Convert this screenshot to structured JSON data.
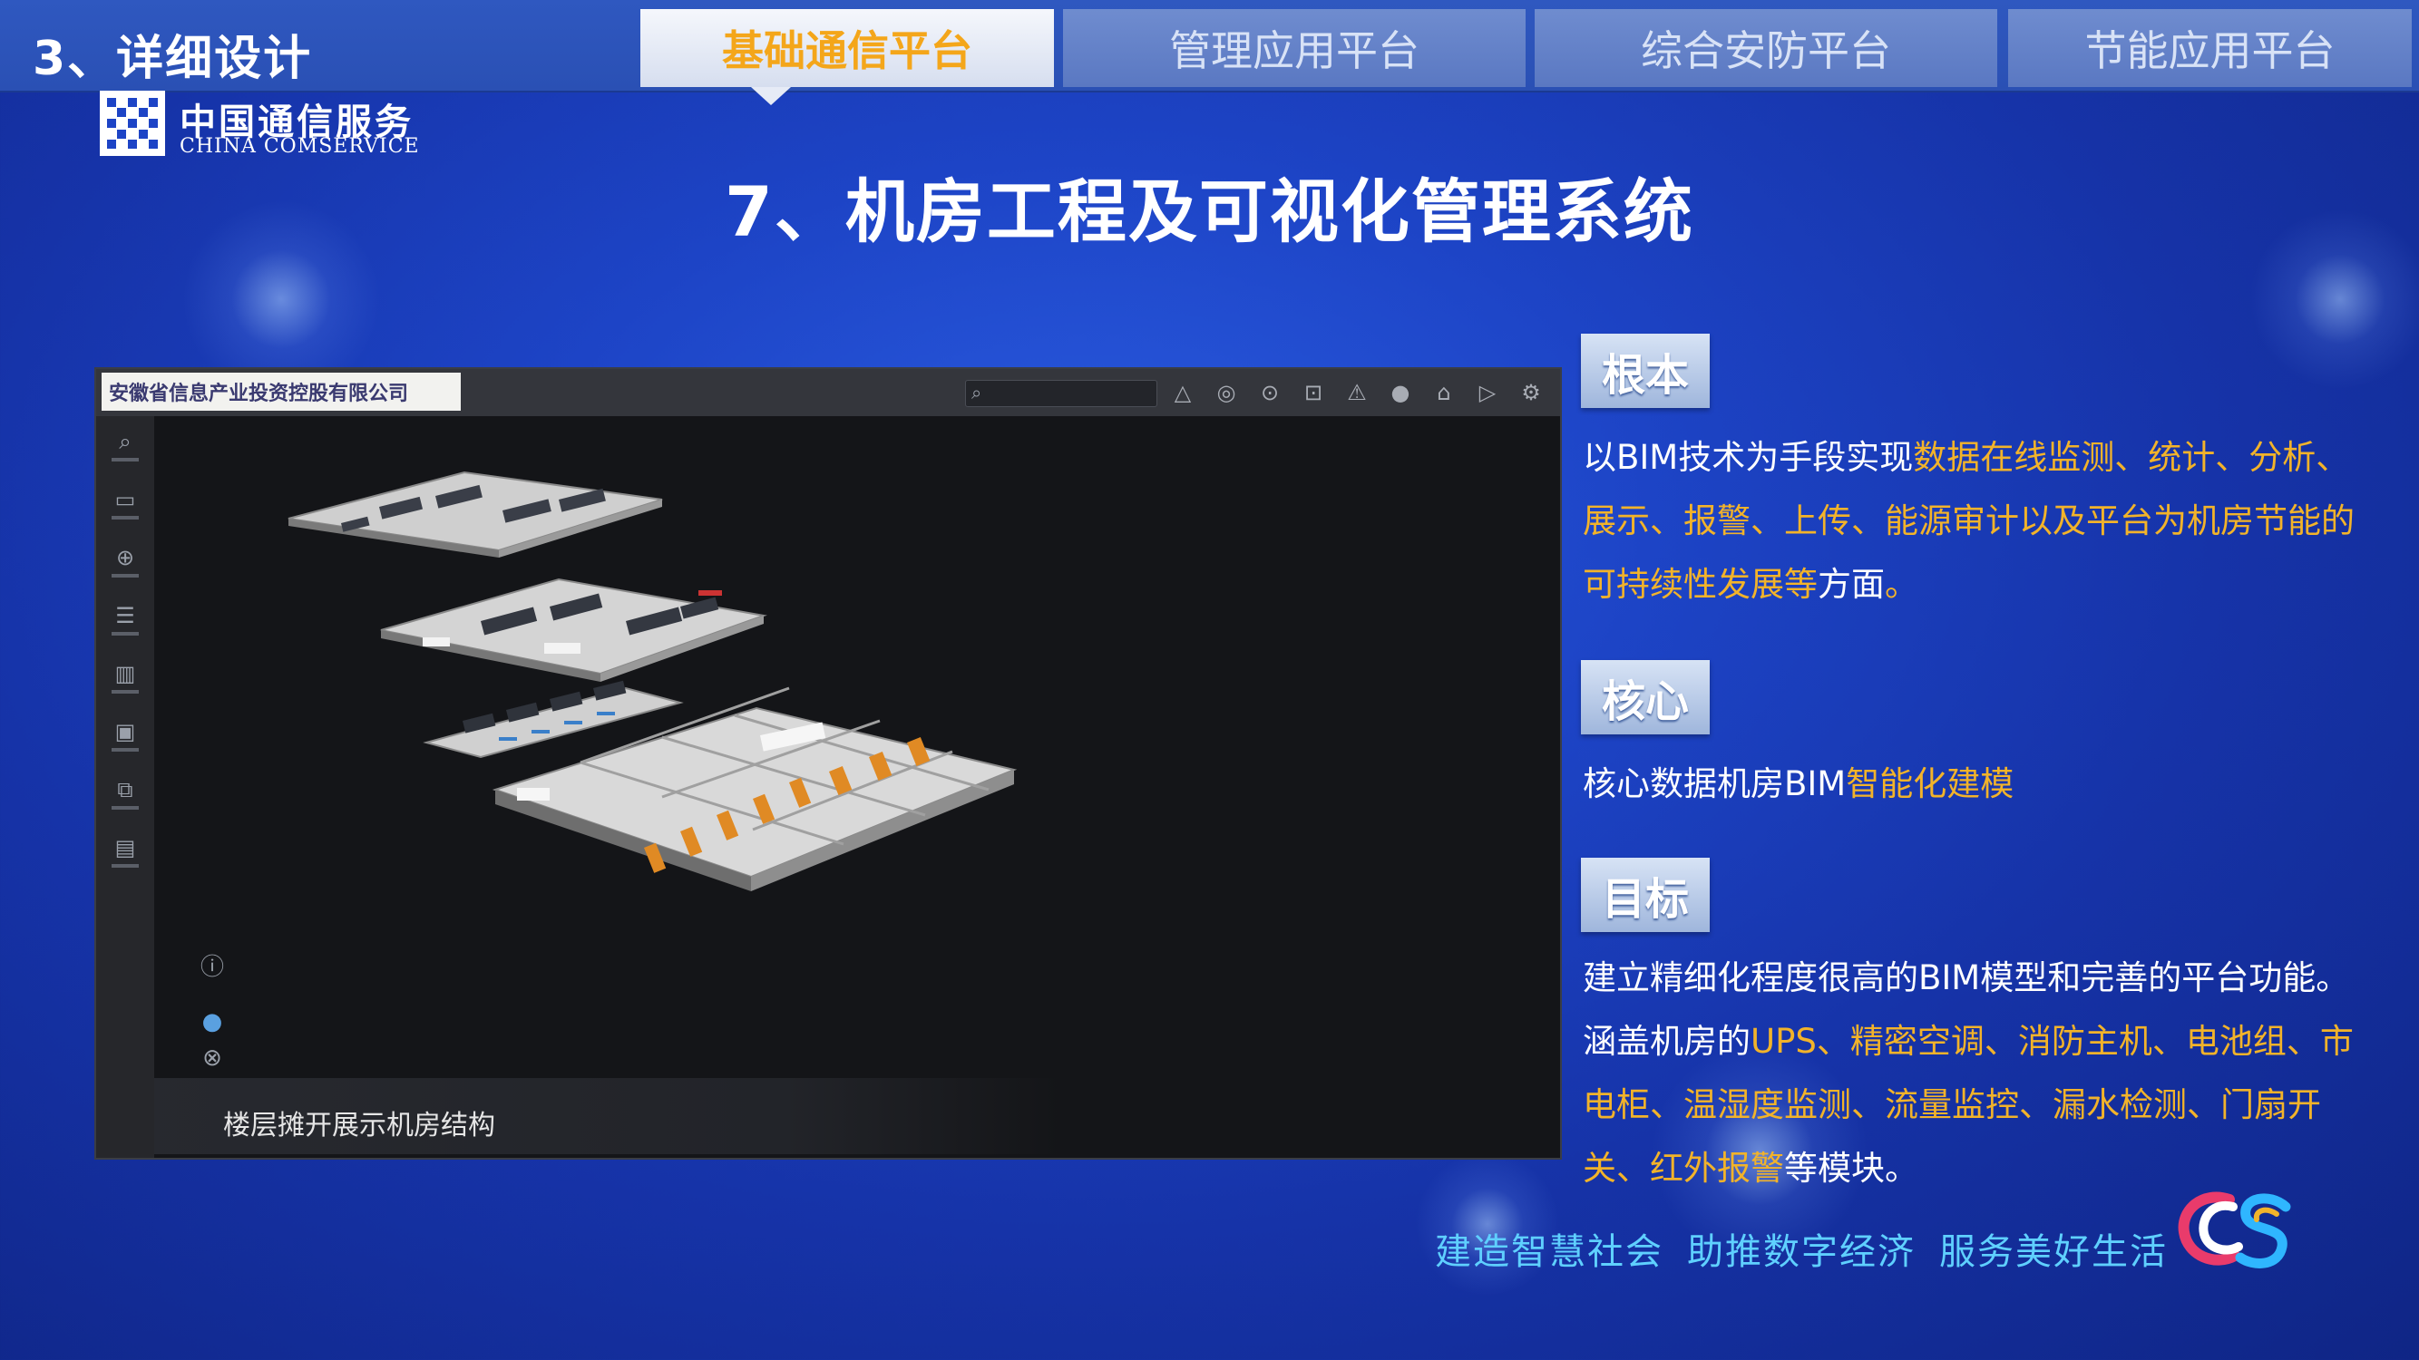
{
  "header": {
    "section_title": "3、详细设计",
    "tabs": [
      {
        "label": "基础通信平台",
        "active": true
      },
      {
        "label": "管理应用平台",
        "active": false
      },
      {
        "label": "综合安防平台",
        "active": false
      },
      {
        "label": "节能应用平台",
        "active": false
      }
    ],
    "logo": {
      "cn": "中国通信服务",
      "en": "CHINA COMSERVICE"
    }
  },
  "title": "7、机房工程及可视化管理系统",
  "screenshot": {
    "banner": "安徽省信息产业投资控股有限公司",
    "caption": "楼层摊开展示机房结构"
  },
  "sections": [
    {
      "tag": "根本",
      "text": [
        {
          "t": "以BIM技术为手段实现",
          "hl": false
        },
        {
          "t": "数据在线监测、统计、分析、展示、报警、上传、能源审计以及平台为机房节能的可持续性发展等",
          "hl": true
        },
        {
          "t": "方面",
          "hl": false
        },
        {
          "t": "。",
          "hl": true
        }
      ]
    },
    {
      "tag": "核心",
      "text": [
        {
          "t": "核心数据机房BIM",
          "hl": false
        },
        {
          "t": "智能化建模",
          "hl": true
        }
      ]
    },
    {
      "tag": "目标",
      "text": [
        {
          "t": "建立精细化程度很高的BIM模型和完善的平台功能。涵盖机房的",
          "hl": false
        },
        {
          "t": "UPS、精密空调、消防主机、电池组、市电柜、温湿度监测、流量监控、漏水检测、门扇开关、红外报警",
          "hl": true
        },
        {
          "t": "等模块。",
          "hl": false
        }
      ]
    }
  ],
  "slogan": [
    "建造智慧社会",
    "助推数字经济",
    "服务美好生活"
  ],
  "colors": {
    "highlight": "#f2b32a",
    "slogan": "#5fd0ff",
    "active_tab_text": "#f4a61a"
  }
}
